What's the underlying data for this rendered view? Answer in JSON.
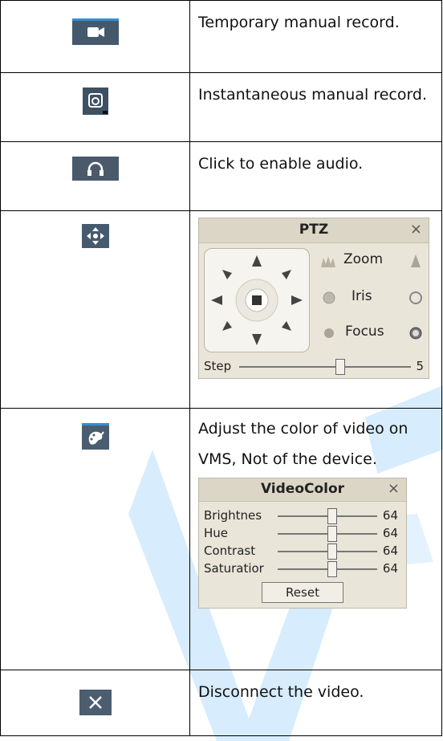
{
  "rows": [
    {
      "icon": "video-camera-icon",
      "text": "Temporary manual record."
    },
    {
      "icon": "snapshot-icon",
      "text": "Instantaneous manual record."
    },
    {
      "icon": "headphones-icon",
      "text": "Click to enable audio."
    },
    {
      "icon": "ptz-move-icon",
      "text": ""
    },
    {
      "icon": "palette-icon",
      "text": "Adjust the color of video on VMS, Not of the device."
    },
    {
      "icon": "close-icon",
      "text": "Disconnect the video."
    }
  ],
  "ptz": {
    "title": "PTZ",
    "close": "×",
    "zoom": "Zoom",
    "iris": "Iris",
    "focus": "Focus",
    "step_label": "Step",
    "step_value": "5"
  },
  "videocolor": {
    "title": "VideoColor",
    "close": "×",
    "sliders": [
      {
        "label": "Brightnes",
        "value": "64"
      },
      {
        "label": "Hue",
        "value": "64"
      },
      {
        "label": "Contrast",
        "value": "64"
      },
      {
        "label": "Saturatior",
        "value": "64"
      }
    ],
    "reset": "Reset"
  },
  "colors": {
    "icon_bg": "#46596c",
    "accent": "#2f8fd6",
    "panel_bg": "#e9e5d9",
    "watermark": "#cfe7fb"
  }
}
